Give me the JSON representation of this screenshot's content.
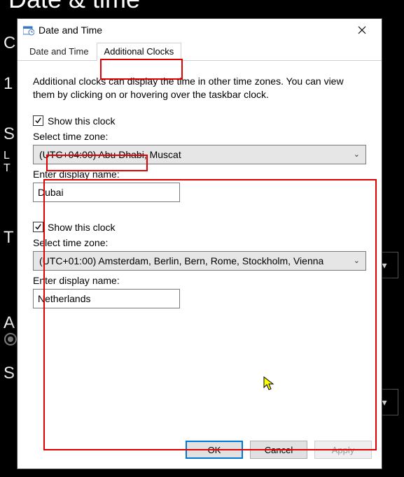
{
  "background": {
    "heading": "Date & time",
    "letters": [
      "C",
      "1",
      "S",
      "L",
      "T",
      "T",
      "A",
      "S"
    ]
  },
  "dialog": {
    "title": "Date and Time",
    "tabs": {
      "tab1": "Date and Time",
      "tab2": "Additional Clocks"
    },
    "intro": "Additional clocks can display the time in other time zones. You can view them by clicking on or hovering over the taskbar clock.",
    "clock1": {
      "show_label": "Show this clock",
      "tz_label": "Select time zone:",
      "tz_value": "(UTC+04:00) Abu Dhabi, Muscat",
      "name_label": "Enter display name:",
      "name_value": "Dubai"
    },
    "clock2": {
      "show_label": "Show this clock",
      "tz_label": "Select time zone:",
      "tz_value": "(UTC+01:00) Amsterdam, Berlin, Bern, Rome, Stockholm, Vienna",
      "name_label": "Enter display name:",
      "name_value": "Netherlands"
    },
    "buttons": {
      "ok": "OK",
      "cancel": "Cancel",
      "apply": "Apply"
    }
  }
}
